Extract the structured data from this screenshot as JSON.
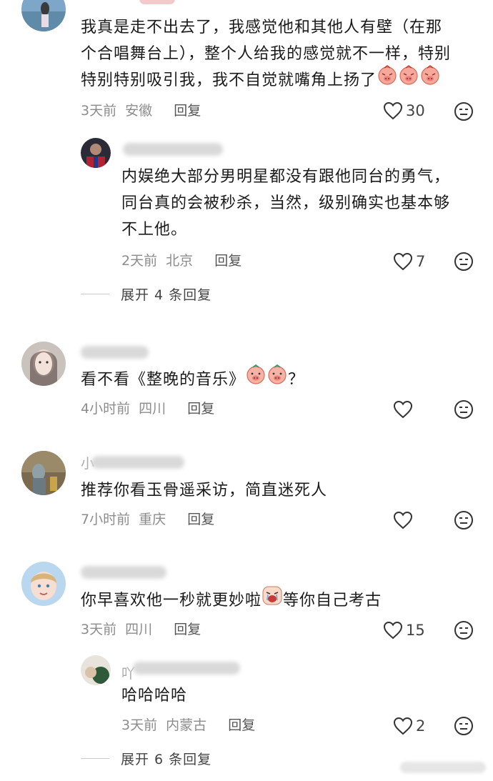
{
  "comments": [
    {
      "id": "c1",
      "text_lines": [
        "我真是走不出去了，我感觉他和其他人有壁（在那",
        "个合唱舞台上），整个人给我的感觉就不一样，特别",
        "特别特别吸引我，我不自觉就嘴角上扬了"
      ],
      "time": "3天前",
      "location": "安徽",
      "reply_label": "回复",
      "likes": "30",
      "replies": [
        {
          "id": "c1r1",
          "text_lines": [
            "内娱绝大部分男明星都没有跟他同台的勇气，",
            "同台真的会被秒杀，当然，级别确实也基本够",
            "不上他。"
          ],
          "time": "2天前",
          "location": "北京",
          "reply_label": "回复",
          "likes": "7"
        }
      ],
      "expand_label": "展开 4 条回复"
    },
    {
      "id": "c2",
      "text_lines": [
        "看不看《整晚的音乐》",
        "？"
      ],
      "time": "4小时前",
      "location": "四川",
      "reply_label": "回复",
      "likes": ""
    },
    {
      "id": "c3",
      "name_prefix": "小",
      "text_lines": [
        "推荐你看玉骨遥采访，简直迷死人"
      ],
      "time": "7小时前",
      "location": "重庆",
      "reply_label": "回复",
      "likes": ""
    },
    {
      "id": "c4",
      "text_lines": [
        "你早喜欢他一秒就更妙啦",
        "等你自己考古"
      ],
      "time": "3天前",
      "location": "四川",
      "reply_label": "回复",
      "likes": "15",
      "replies": [
        {
          "id": "c4r1",
          "name_prefix": "吖",
          "text_lines": [
            "哈哈哈哈"
          ],
          "time": "3天前",
          "location": "内蒙古",
          "reply_label": "回复",
          "likes": "2"
        }
      ],
      "expand_label": "展开 6 条回复"
    }
  ],
  "icons": {
    "like": "heart-outline-icon",
    "dislike": "dislike-face-icon",
    "emoji": "pig-blush-emoji"
  },
  "colors": {
    "text": "#1a1a1a",
    "meta": "#8c8c8c",
    "icon": "#333333"
  }
}
